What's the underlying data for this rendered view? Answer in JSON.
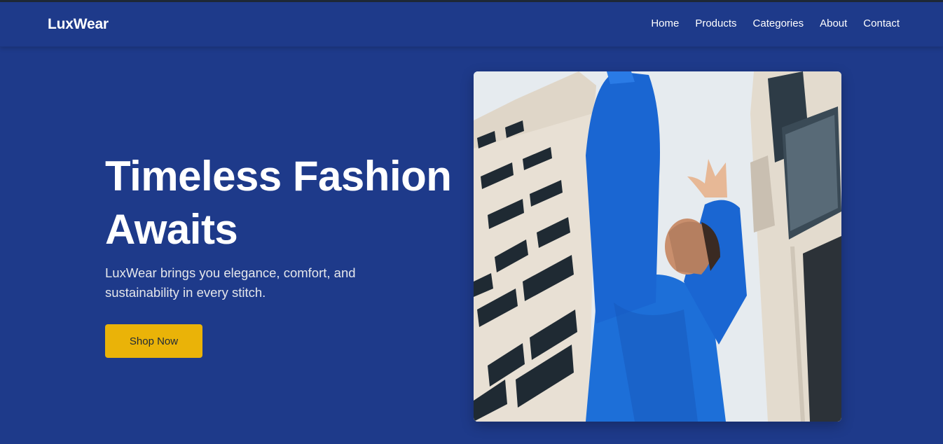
{
  "brand": {
    "name": "LuxWear"
  },
  "nav": {
    "items": [
      {
        "label": "Home"
      },
      {
        "label": "Products"
      },
      {
        "label": "Categories"
      },
      {
        "label": "About"
      },
      {
        "label": "Contact"
      }
    ]
  },
  "hero": {
    "title_line1": "Timeless Fashion",
    "title_line2": "Awaits",
    "subtitle": "LuxWear brings you elegance, comfort, and sustainability in every stitch.",
    "cta_label": "Shop Now"
  },
  "colors": {
    "background": "#1e3a8a",
    "accent": "#eab308",
    "text": "#ffffff"
  }
}
